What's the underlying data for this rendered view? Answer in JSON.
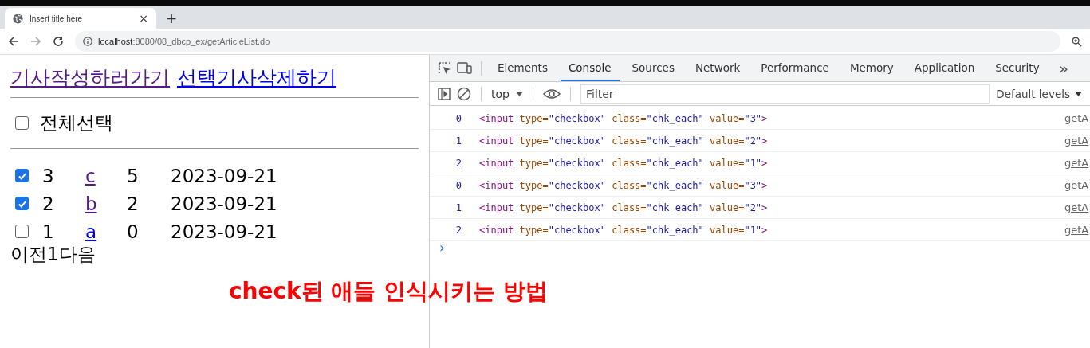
{
  "browser": {
    "tab": {
      "title": "Insert title here",
      "close": "×"
    },
    "new_tab": "+",
    "address": {
      "host": "localhost",
      "rest": ":8080/08_dbcp_ex/getArticleList.do"
    }
  },
  "page": {
    "links": [
      {
        "text": "기사작성하러가기",
        "visited": true
      },
      {
        "text": "선택기사삭제하기",
        "visited": false
      }
    ],
    "select_all": {
      "label": "전체선택",
      "checked": false
    },
    "rows": [
      {
        "checked": true,
        "no": "3",
        "title": "c",
        "visited": true,
        "count": "5",
        "date": "2023-09-21"
      },
      {
        "checked": true,
        "no": "2",
        "title": "b",
        "visited": true,
        "count": "2",
        "date": "2023-09-21"
      },
      {
        "checked": false,
        "no": "1",
        "title": "a",
        "visited": false,
        "count": "0",
        "date": "2023-09-21"
      }
    ],
    "pagination": "이전1다음"
  },
  "devtools": {
    "tabs": [
      {
        "label": "Elements",
        "selected": false
      },
      {
        "label": "Console",
        "selected": true
      },
      {
        "label": "Sources",
        "selected": false
      },
      {
        "label": "Network",
        "selected": false
      },
      {
        "label": "Performance",
        "selected": false
      },
      {
        "label": "Memory",
        "selected": false
      },
      {
        "label": "Application",
        "selected": false
      },
      {
        "label": "Security",
        "selected": false
      }
    ],
    "more": "»",
    "context": "top",
    "filter_placeholder": "Filter",
    "levels": "Default levels",
    "logs": [
      {
        "index": "0",
        "tag_open": "<input",
        "attributes": [
          {
            "name": "type=",
            "value": "\"checkbox\""
          },
          {
            "name": "class=",
            "value": "\"chk_each\""
          },
          {
            "name": "value=",
            "value": "\"3\""
          }
        ],
        "tag_close": ">",
        "source": "getA"
      },
      {
        "index": "1",
        "tag_open": "<input",
        "attributes": [
          {
            "name": "type=",
            "value": "\"checkbox\""
          },
          {
            "name": "class=",
            "value": "\"chk_each\""
          },
          {
            "name": "value=",
            "value": "\"2\""
          }
        ],
        "tag_close": ">",
        "source": "getA"
      },
      {
        "index": "2",
        "tag_open": "<input",
        "attributes": [
          {
            "name": "type=",
            "value": "\"checkbox\""
          },
          {
            "name": "class=",
            "value": "\"chk_each\""
          },
          {
            "name": "value=",
            "value": "\"1\""
          }
        ],
        "tag_close": ">",
        "source": "getA"
      },
      {
        "index": "0",
        "tag_open": "<input",
        "attributes": [
          {
            "name": "type=",
            "value": "\"checkbox\""
          },
          {
            "name": "class=",
            "value": "\"chk_each\""
          },
          {
            "name": "value=",
            "value": "\"3\""
          }
        ],
        "tag_close": ">",
        "source": "getA"
      },
      {
        "index": "1",
        "tag_open": "<input",
        "attributes": [
          {
            "name": "type=",
            "value": "\"checkbox\""
          },
          {
            "name": "class=",
            "value": "\"chk_each\""
          },
          {
            "name": "value=",
            "value": "\"2\""
          }
        ],
        "tag_close": ">",
        "source": "getA"
      },
      {
        "index": "2",
        "tag_open": "<input",
        "attributes": [
          {
            "name": "type=",
            "value": "\"checkbox\""
          },
          {
            "name": "class=",
            "value": "\"chk_each\""
          },
          {
            "name": "value=",
            "value": "\"1\""
          }
        ],
        "tag_close": ">",
        "source": "getA"
      }
    ],
    "prompt": "›"
  },
  "annotation": "check된 애들 인식시키는 방법"
}
